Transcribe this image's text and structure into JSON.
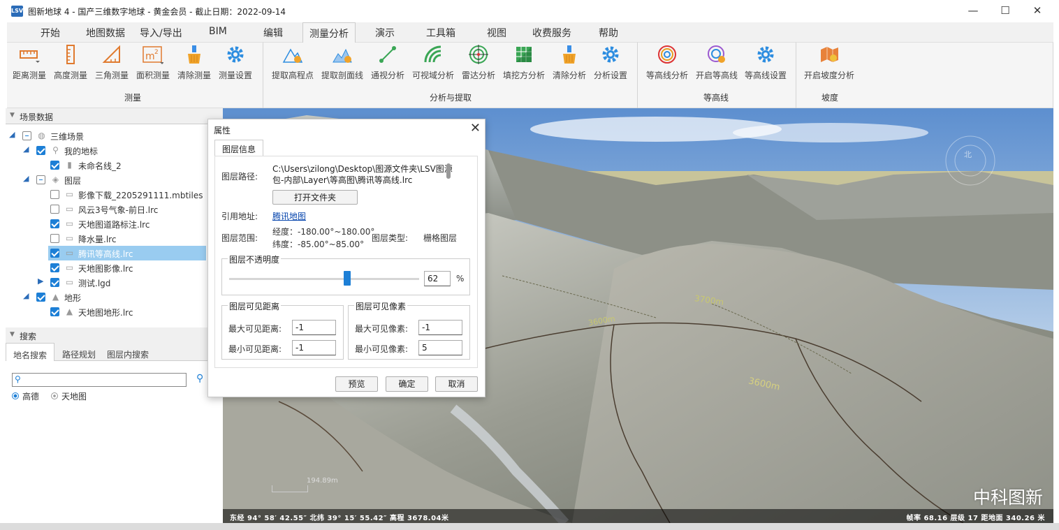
{
  "titlebar": {
    "title": "图新地球 4 - 国产三维数字地球 - 黄金会员 - 截止日期：2022-09-14",
    "logo": "LSV",
    "minimize": "—",
    "maximize": "☐",
    "close": "✕"
  },
  "tabs": [
    "开始",
    "地图数据",
    "导入/导出",
    "BIM",
    "编辑",
    "测量分析",
    "演示",
    "工具箱",
    "视图",
    "收费服务",
    "帮助"
  ],
  "ribbon": {
    "measure": {
      "label": "测量",
      "items": [
        "距离测量",
        "高度测量",
        "三角测量",
        "面积测量",
        "清除测量",
        "测量设置"
      ]
    },
    "analysis": {
      "label": "分析与提取",
      "items": [
        "提取高程点",
        "提取剖面线",
        "通视分析",
        "可视域分析",
        "雷达分析",
        "填挖方分析",
        "清除分析",
        "分析设置"
      ]
    },
    "contour": {
      "label": "等高线",
      "items": [
        "等高线分析",
        "开启等高线",
        "等高线设置"
      ]
    },
    "slope": {
      "label": "坡度",
      "items": [
        "开启坡度分析"
      ]
    }
  },
  "left": {
    "scene_header": "场景数据",
    "tree": [
      "三维场景",
      "我的地标",
      "未命名线_2",
      "图层",
      "影像下载_2205291111.mbtiles",
      "风云3号气象-前日.lrc",
      "天地图道路标注.lrc",
      "降水量.lrc",
      "腾讯等高线.lrc",
      "天地图影像.lrc",
      "测试.lgd",
      "地形",
      "天地图地形.lrc"
    ],
    "search_header": "搜索",
    "search_tabs": [
      "地名搜索",
      "路径规划",
      "图层内搜索"
    ],
    "search_placeholder": "",
    "radio": [
      "高德",
      "天地图"
    ]
  },
  "dialog": {
    "title": "属性",
    "close": "✕",
    "tab": "图层信息",
    "path_label": "图层路径:",
    "path_value": "C:\\Users\\zilong\\Desktop\\图源文件夹\\LSV图源包-内部\\Layer\\等高图\\腾讯等高线.lrc",
    "open_folder": "打开文件夹",
    "ref_label": "引用地址:",
    "ref_link": "腾讯地图",
    "range_label": "图层范围:",
    "lon": "经度：-180.00°~180.00°",
    "lat": "纬度：-85.00°~85.00°",
    "type_label": "图层类型:",
    "type_value": "栅格图层",
    "opacity_title": "图层不透明度",
    "opacity_value": "62",
    "opacity_unit": "%",
    "opacity_fraction": 0.62,
    "dist_title": "图层可见距离",
    "max_dist_label": "最大可见距离:",
    "max_dist": "-1",
    "min_dist_label": "最小可见距离:",
    "min_dist": "-1",
    "pix_title": "图层可见像素",
    "max_pix_label": "最大可见像素:",
    "max_pix": "-1",
    "min_pix_label": "最小可见像素:",
    "min_pix": "5",
    "preview": "预览",
    "ok": "确定",
    "cancel": "取消"
  },
  "map": {
    "labels": [
      "3700m",
      "3600m",
      "3600m"
    ],
    "scale": "194.89m",
    "compass": "北",
    "watermark": "中科图新",
    "status_left": "东经 94° 58′ 42.55″ 北纬 39° 15′ 55.42″  高程 3678.04米",
    "status_right": "帧率 68.16  层级 17  距地面 340.26 米"
  },
  "colors": {
    "accent": "#1d7fd6",
    "highlight": "#99ccf0",
    "link": "#0645ad"
  }
}
